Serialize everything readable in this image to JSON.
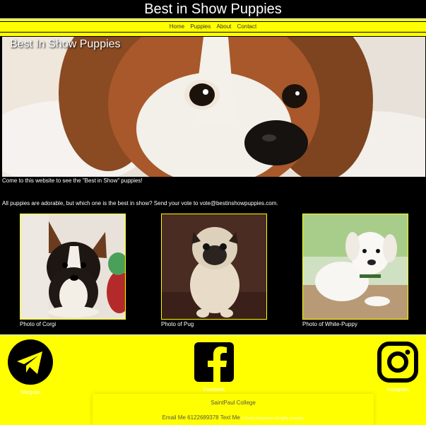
{
  "header": {
    "title": "Best in Show Puppies"
  },
  "nav": {
    "items": [
      "Home",
      "Puppies",
      "About",
      "Contact"
    ]
  },
  "hero": {
    "title": "Best In Show Puppies"
  },
  "intro": {
    "line1": "Come to this website to see the \"Best in Show\" puppies!",
    "line2": "All puppies are adorable, but which one is the best in show? Send your vote to vote@bestinshowpuppies.com."
  },
  "gallery": [
    {
      "caption": "Photo of Corgi"
    },
    {
      "caption": "Photo of Pug"
    },
    {
      "caption": "Photo of White-Puppy"
    }
  ],
  "footer": {
    "social": [
      {
        "label": "Telegram",
        "icon": "telegram-icon"
      },
      {
        "label": "Facebook",
        "icon": "facebook-icon"
      },
      {
        "label": "Instagram",
        "icon": "instagram-icon"
      }
    ],
    "college": "SaintPaul College",
    "email": "Email Me",
    "phone": "6122689378",
    "text": "Text Me",
    "copyright": "© Cedric Amundsen, All rights reserved."
  },
  "colors": {
    "accent": "#ffff00",
    "background": "#000000"
  }
}
